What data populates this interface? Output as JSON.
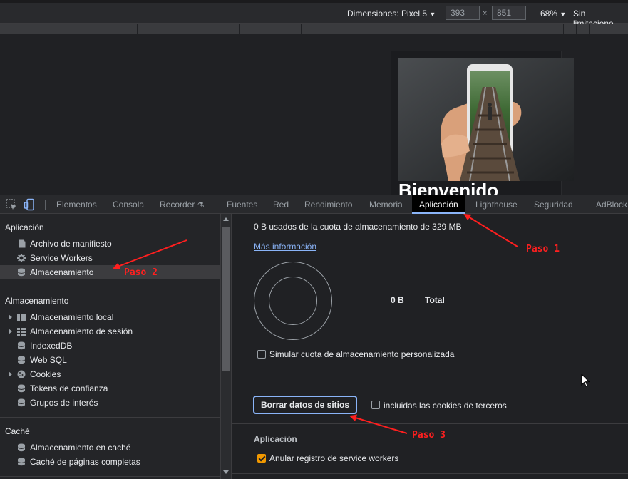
{
  "device_toolbar": {
    "dimensions_label": "Dimensiones: Pixel 5",
    "width": "393",
    "height": "851",
    "separator": "×",
    "zoom": "68%",
    "throttle": "Sin limitacione"
  },
  "viewport": {
    "welcome_text": "Bienvenido"
  },
  "tabs": [
    {
      "label": "Elementos"
    },
    {
      "label": "Consola"
    },
    {
      "label": "Recorder"
    },
    {
      "label": "Fuentes"
    },
    {
      "label": "Red"
    },
    {
      "label": "Rendimiento"
    },
    {
      "label": "Memoria"
    },
    {
      "label": "Aplicación"
    },
    {
      "label": "Lighthouse"
    },
    {
      "label": "Seguridad"
    },
    {
      "label": "AdBlock"
    }
  ],
  "sidebar": {
    "app_section": "Aplicación",
    "app_items": [
      {
        "label": "Archivo de manifiesto",
        "icon": "document-icon"
      },
      {
        "label": "Service Workers",
        "icon": "gear-icon"
      },
      {
        "label": "Almacenamiento",
        "icon": "database-icon"
      }
    ],
    "storage_section": "Almacenamiento",
    "storage_items": [
      {
        "label": "Almacenamiento local",
        "icon": "grid-icon"
      },
      {
        "label": "Almacenamiento de sesión",
        "icon": "grid-icon"
      },
      {
        "label": "IndexedDB",
        "icon": "database-icon"
      },
      {
        "label": "Web SQL",
        "icon": "database-icon"
      },
      {
        "label": "Cookies",
        "icon": "cookie-icon"
      },
      {
        "label": "Tokens de confianza",
        "icon": "database-icon"
      },
      {
        "label": "Grupos de interés",
        "icon": "database-icon"
      }
    ],
    "cache_section": "Caché",
    "cache_items": [
      {
        "label": "Almacenamiento en caché",
        "icon": "database-icon"
      },
      {
        "label": "Caché de páginas completas",
        "icon": "database-icon"
      }
    ]
  },
  "main": {
    "quota_text": "0 B usados de la cuota de almacenamiento de 329 MB",
    "more_info": "Más información",
    "total_value": "0 B",
    "total_label": "Total",
    "simulate_label": "Simular cuota de almacenamiento personalizada",
    "simulate_checked": false,
    "clear_button": "Borrar datos de sitios",
    "third_party_label": "incluidas las cookies de terceros",
    "third_party_checked": false,
    "app_section": "Aplicación",
    "unregister_label": "Anular registro de service workers",
    "unregister_checked": true
  },
  "annotations": {
    "step1": "Paso 1",
    "step2": "Paso 2",
    "step3": "Paso 3",
    "color": "#ff1f1f"
  },
  "colors": {
    "accent": "#8ab4f8",
    "checkbox_checked": "#f29900",
    "panel_bg": "#202124"
  }
}
